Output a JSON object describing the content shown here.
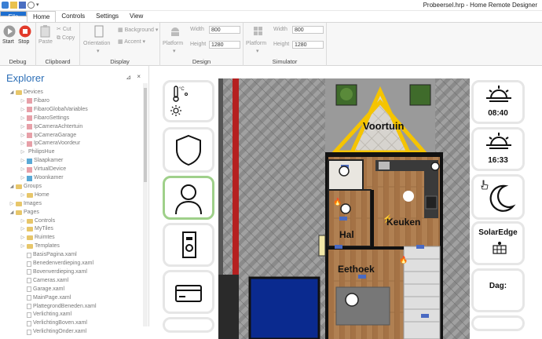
{
  "app": {
    "title": "Probeersel.hrp - Home Remote Designer"
  },
  "menu": {
    "tabs": [
      "File",
      "Home",
      "Controls",
      "Settings",
      "View"
    ]
  },
  "ribbon": {
    "debug": {
      "label": "Debug",
      "start": "Start",
      "stop": "Stop"
    },
    "clipboard": {
      "label": "Clipboard",
      "paste": "Paste",
      "cut": "Cut",
      "copy": "Copy"
    },
    "display": {
      "label": "Display",
      "orientation": "Orientation",
      "background": "Background",
      "accent": "Accent"
    },
    "design": {
      "label": "Design",
      "platform": "Platform",
      "width_label": "Width",
      "width_value": "800",
      "height_label": "Height",
      "height_value": "1280"
    },
    "simulator": {
      "label": "Simulator",
      "platform": "Platform",
      "width_label": "Width",
      "width_value": "800",
      "height_label": "Height",
      "height_value": "1280"
    }
  },
  "explorer": {
    "title": "Explorer",
    "pin": "⊿",
    "close": "×",
    "tree": [
      {
        "label": "Devices",
        "kind": "folder",
        "level": 1,
        "expanded": true
      },
      {
        "label": "Fibaro",
        "kind": "dev",
        "level": 2
      },
      {
        "label": "FibaroGlobalVariables",
        "kind": "dev",
        "level": 2
      },
      {
        "label": "FibaroSettings",
        "kind": "dev",
        "level": 2
      },
      {
        "label": "IpCameraAchtertuin",
        "kind": "dev",
        "level": 2
      },
      {
        "label": "IpCameraGarage",
        "kind": "dev",
        "level": 2
      },
      {
        "label": "IpCameraVoordeur",
        "kind": "dev",
        "level": 2
      },
      {
        "label": "PhilipsHue",
        "kind": "none",
        "level": 2
      },
      {
        "label": "Slaapkamer",
        "kind": "devb",
        "level": 2
      },
      {
        "label": "VirtualDevice",
        "kind": "dev",
        "level": 2
      },
      {
        "label": "Woonkamer",
        "kind": "devb",
        "level": 2
      },
      {
        "label": "Groups",
        "kind": "folder",
        "level": 1,
        "expanded": true
      },
      {
        "label": "Home",
        "kind": "folder",
        "level": 2
      },
      {
        "label": "Images",
        "kind": "folder",
        "level": 1
      },
      {
        "label": "Pages",
        "kind": "folder",
        "level": 1,
        "expanded": true
      },
      {
        "label": "Controls",
        "kind": "folder",
        "level": 2
      },
      {
        "label": "MyTiles",
        "kind": "folder",
        "level": 2
      },
      {
        "label": "Ruimtes",
        "kind": "folder",
        "level": 2
      },
      {
        "label": "Templates",
        "kind": "folder",
        "level": 2
      },
      {
        "label": "BasisPagina.xaml",
        "kind": "file",
        "level": 2
      },
      {
        "label": "Benedenverdieping.xaml",
        "kind": "file",
        "level": 2
      },
      {
        "label": "Bovenverdieping.xaml",
        "kind": "file",
        "level": 2
      },
      {
        "label": "Cameras.xaml",
        "kind": "file",
        "level": 2
      },
      {
        "label": "Garage.xaml",
        "kind": "file",
        "level": 2
      },
      {
        "label": "MainPage.xaml",
        "kind": "file",
        "level": 2
      },
      {
        "label": "PlattegrondBeneden.xaml",
        "kind": "file",
        "level": 2
      },
      {
        "label": "Verlichting.xaml",
        "kind": "file",
        "level": 2
      },
      {
        "label": "VerlichtingBoven.xaml",
        "kind": "file",
        "level": 2
      },
      {
        "label": "VerlichtingOnder.xaml",
        "kind": "file",
        "level": 2
      }
    ]
  },
  "floorplan": {
    "voortuin": "Voortuin",
    "keuken": "Keuken",
    "hal": "Hal",
    "eethoek": "Eethoek"
  },
  "right_tiles": {
    "sunrise_time": "08:40",
    "sunset_time": "16:33",
    "solaredge": "SolarEdge",
    "dag": "Dag:"
  },
  "left_tiles": {
    "temp_unit": "°C"
  },
  "colors": {
    "accent": "#1e6fd0",
    "selected_tile": "#9fd08a",
    "explorer_title": "#2d6fb7",
    "stop": "#e23a2a"
  }
}
